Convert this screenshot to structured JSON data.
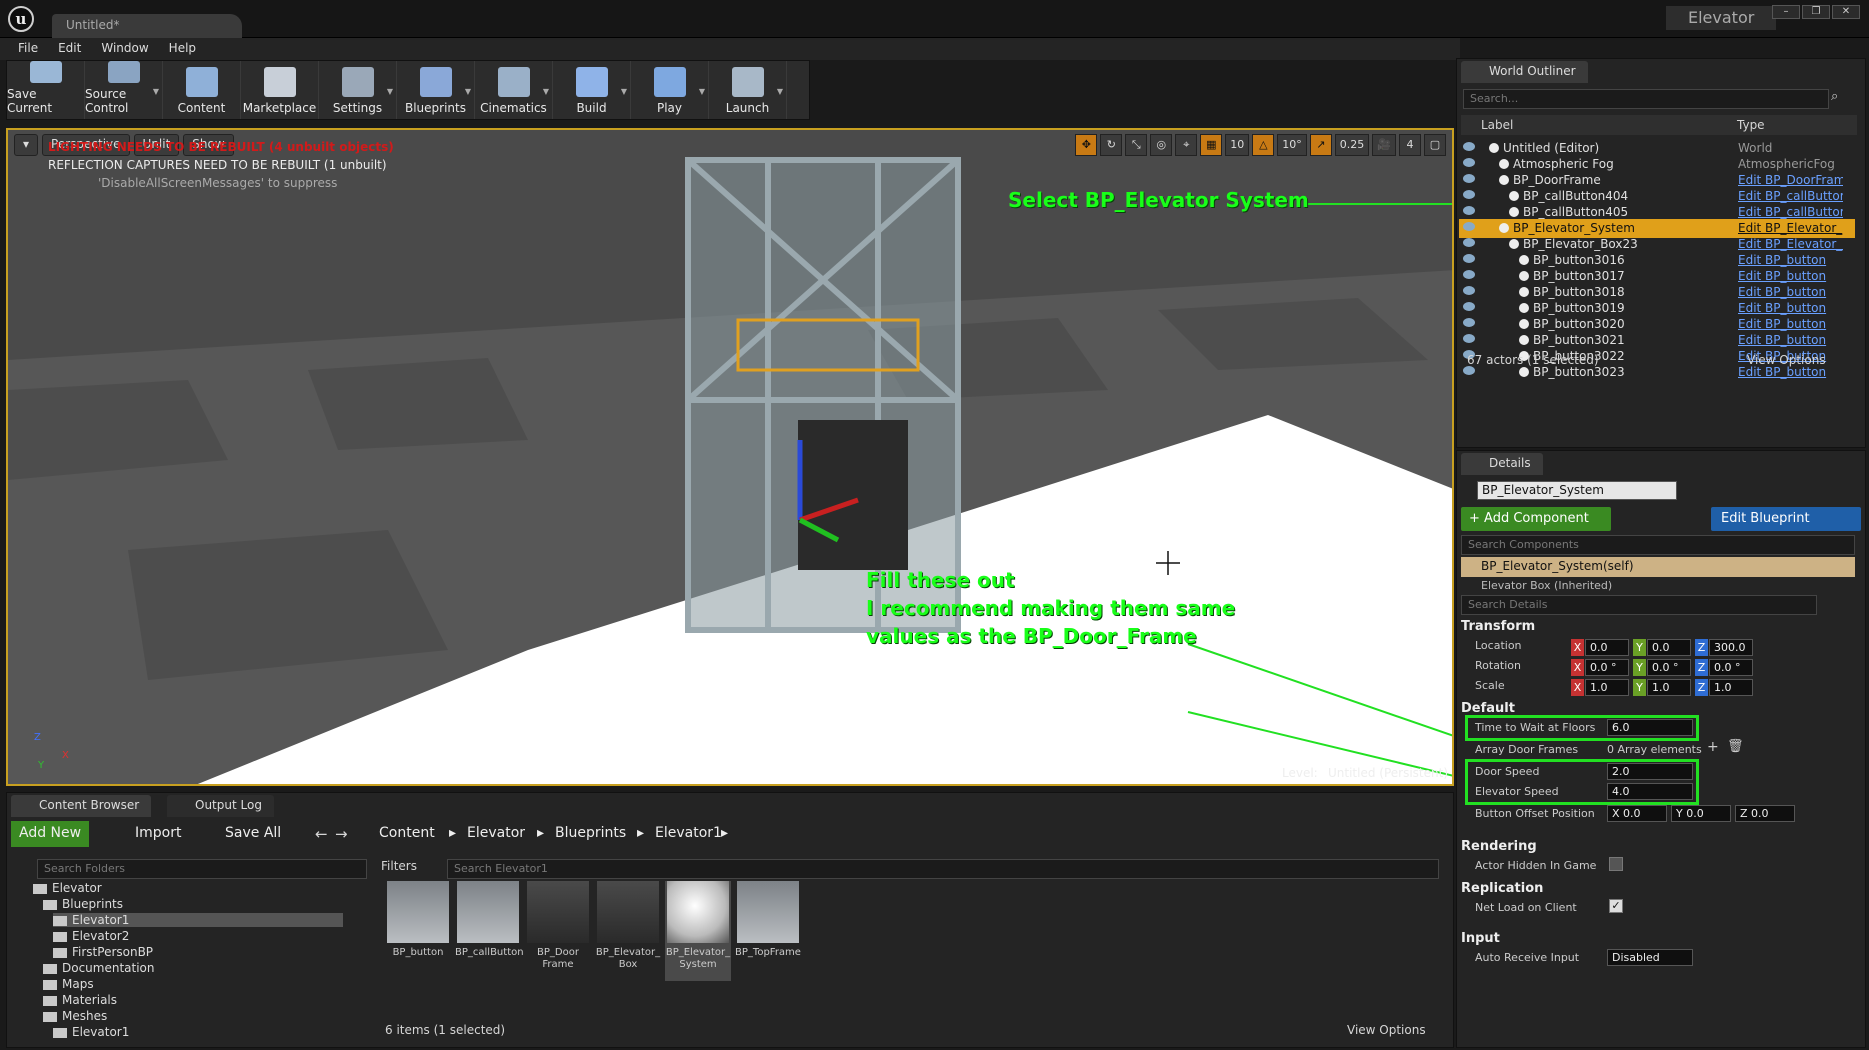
{
  "window": {
    "tab_title": "Untitled*",
    "project": "Elevator",
    "controls": [
      "–",
      "❐",
      "✕"
    ]
  },
  "menu": [
    "File",
    "Edit",
    "Window",
    "Help"
  ],
  "toolbar": [
    {
      "label": "Save Current",
      "icon": "save-icon",
      "color": "#9ab7d6"
    },
    {
      "label": "Source Control",
      "icon": "source-control-icon",
      "color": "#8aa4c2"
    },
    {
      "label": "Content",
      "icon": "content-icon",
      "color": "#8fb0d8"
    },
    {
      "label": "Marketplace",
      "icon": "marketplace-icon",
      "color": "#c8cfd8"
    },
    {
      "label": "Settings",
      "icon": "settings-icon",
      "color": "#9aa8b8"
    },
    {
      "label": "Blueprints",
      "icon": "blueprints-icon",
      "color": "#8aa8d8"
    },
    {
      "label": "Cinematics",
      "icon": "cinematics-icon",
      "color": "#9ab0c8"
    },
    {
      "label": "Build",
      "icon": "build-icon",
      "color": "#8fb3e8"
    },
    {
      "label": "Play",
      "icon": "play-icon",
      "color": "#7ea8e0"
    },
    {
      "label": "Launch",
      "icon": "launch-icon",
      "color": "#a8b8c8"
    }
  ],
  "viewport": {
    "perspective": "Perspective",
    "unlit": "Unlit",
    "show": "Show",
    "grid_snap": "10",
    "rot_snap": "10°",
    "scale_snap": "0.25",
    "cam_speed": "4",
    "msg_lighting": "LIGHTING NEEDS TO BE REBUILT (4 unbuilt objects)",
    "msg_reflection": "REFLECTION CAPTURES NEED TO BE REBUILT (1 unbuilt)",
    "msg_suppress": "'DisableAllScreenMessages' to suppress",
    "level_label": "Level:",
    "level_name": "Untitled (Persistent)",
    "axis_z": "Z",
    "axis_x": "X",
    "axis_y": "Y"
  },
  "annotations": {
    "select": "Select BP_Elevator System",
    "fill1": "Fill these out",
    "fill2": "I recommend making them same",
    "fill3": "values as the BP_Door_Frame"
  },
  "outliner": {
    "tab": "World Outliner",
    "search_placeholder": "Search...",
    "col_label": "Label",
    "col_type": "Type",
    "rows": [
      {
        "label": "Untitled (Editor)",
        "type": "World",
        "link": false
      },
      {
        "label": "Atmospheric Fog",
        "type": "AtmosphericFog",
        "link": false
      },
      {
        "label": "BP_DoorFrame",
        "type": "Edit BP_DoorFram",
        "link": true
      },
      {
        "label": "BP_callButton404",
        "type": "Edit BP_callButtor",
        "link": true
      },
      {
        "label": "BP_callButton405",
        "type": "Edit BP_callButtor",
        "link": true
      },
      {
        "label": "BP_Elevator_System",
        "type": "Edit BP_Elevator_",
        "link": true
      },
      {
        "label": "BP_Elevator_Box23",
        "type": "Edit BP_Elevator_I",
        "link": true
      },
      {
        "label": "BP_button3016",
        "type": "Edit BP_button",
        "link": true
      },
      {
        "label": "BP_button3017",
        "type": "Edit BP_button",
        "link": true
      },
      {
        "label": "BP_button3018",
        "type": "Edit BP_button",
        "link": true
      },
      {
        "label": "BP_button3019",
        "type": "Edit BP_button",
        "link": true
      },
      {
        "label": "BP_button3020",
        "type": "Edit BP_button",
        "link": true
      },
      {
        "label": "BP_button3021",
        "type": "Edit BP_button",
        "link": true
      },
      {
        "label": "BP_button3022",
        "type": "Edit BP_button",
        "link": true
      },
      {
        "label": "BP_button3023",
        "type": "Edit BP_button",
        "link": true
      }
    ],
    "footer": "67 actors (1 selected)",
    "view_options": "View Options"
  },
  "details": {
    "tab": "Details",
    "name": "BP_Elevator_System",
    "add_component": "+ Add Component",
    "edit_blueprint": "Edit Blueprint",
    "search_components": "Search Components",
    "self_row": "BP_Elevator_System(self)",
    "inherited_row": "Elevator Box (Inherited)",
    "search_details": "Search Details",
    "transform": "Transform",
    "location": "Location",
    "loc": [
      "0.0",
      "0.0",
      "300.0"
    ],
    "rotation": "Rotation",
    "rot": [
      "0.0 °",
      "0.0 °",
      "0.0 °"
    ],
    "scale": "Scale",
    "scl": [
      "1.0",
      "1.0",
      "1.0"
    ],
    "default": "Default",
    "time_wait": "Time to Wait at Floors",
    "time_wait_val": "6.0",
    "array_door": "Array Door Frames",
    "array_door_val": "0 Array elements",
    "door_speed": "Door Speed",
    "door_speed_val": "2.0",
    "elev_speed": "Elevator Speed",
    "elev_speed_val": "4.0",
    "button_offset": "Button Offset Position",
    "bo": [
      "X 0.0",
      "Y 0.0",
      "Z 0.0"
    ],
    "rendering": "Rendering",
    "hidden": "Actor Hidden In Game",
    "replication": "Replication",
    "netload": "Net Load on Client",
    "input": "Input",
    "auto_input": "Auto Receive Input",
    "auto_input_val": "Disabled"
  },
  "content_browser": {
    "tab1": "Content Browser",
    "tab2": "Output Log",
    "add_new": "Add New",
    "import": "Import",
    "save_all": "Save All",
    "path": [
      "Content",
      "Elevator",
      "Blueprints",
      "Elevator1"
    ],
    "search_folders": "Search Folders",
    "filters": "Filters",
    "search_assets": "Search Elevator1",
    "tree": [
      {
        "label": "Elevator",
        "indent": 0
      },
      {
        "label": "Blueprints",
        "indent": 1
      },
      {
        "label": "Elevator1",
        "indent": 2
      },
      {
        "label": "Elevator2",
        "indent": 2
      },
      {
        "label": "FirstPersonBP",
        "indent": 2
      },
      {
        "label": "Documentation",
        "indent": 1
      },
      {
        "label": "Maps",
        "indent": 1
      },
      {
        "label": "Materials",
        "indent": 1
      },
      {
        "label": "Meshes",
        "indent": 1
      },
      {
        "label": "Elevator1",
        "indent": 2
      }
    ],
    "assets": [
      {
        "name": "BP_button"
      },
      {
        "name": "BP_callButton"
      },
      {
        "name": "BP_Door Frame"
      },
      {
        "name": "BP_Elevator_ Box"
      },
      {
        "name": "BP_Elevator_ System"
      },
      {
        "name": "BP_TopFrame"
      }
    ],
    "footer": "6 items (1 selected)",
    "view_options": "View Options"
  }
}
